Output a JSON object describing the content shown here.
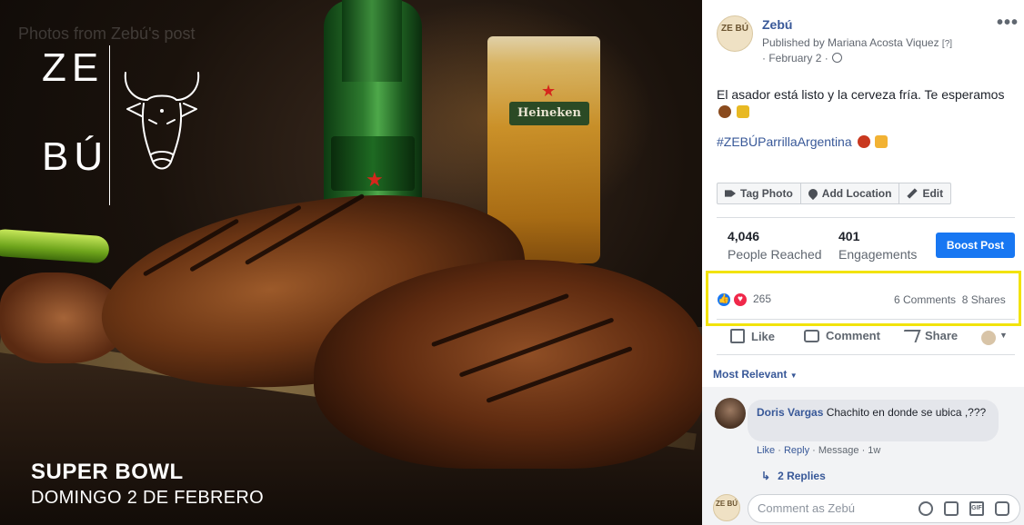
{
  "photo": {
    "caption": "Photos from Zebú's post",
    "logo_line1": "ZE",
    "logo_line2": "BÚ",
    "bull_icon": "bull-head-icon",
    "bottle_label": "Heineken",
    "promo_title": "SUPER BOWL",
    "promo_subtitle": "DOMINGO 2 DE FEBRERO"
  },
  "post": {
    "page_name": "Zebú",
    "avatar_text": "ZE BÚ",
    "published_by": "Published by Mariana Acosta Viquez",
    "help_mark": "[?]",
    "date": "February 2",
    "text": "El asador está listo y la cerveza fría. Te esperamos",
    "hashtag": "#ZEBÚParrillaArgentina",
    "more_icon": "more-horizontal-icon"
  },
  "photo_actions": {
    "tag": "Tag Photo",
    "location": "Add Location",
    "edit": "Edit"
  },
  "insights": {
    "reached_value": "4,046",
    "reached_label": "People Reached",
    "engagements_value": "401",
    "engagements_label": "Engagements",
    "boost_label": "Boost Post"
  },
  "reactions": {
    "count": "265",
    "comments": "6 Comments",
    "shares": "8 Shares"
  },
  "actions": {
    "like": "Like",
    "comment": "Comment",
    "share": "Share"
  },
  "comments": {
    "sort_label": "Most Relevant",
    "items": [
      {
        "author": "Doris Vargas",
        "text": "Chachito en donde se ubica ,???",
        "like": "Like",
        "reply": "Reply",
        "message": "Message",
        "time": "1w",
        "replies": "2 Replies"
      }
    ],
    "composer_placeholder": "Comment as Zebú"
  },
  "colors": {
    "brand_blue": "#1877f2",
    "link": "#385898",
    "highlight": "#f2e30b"
  }
}
